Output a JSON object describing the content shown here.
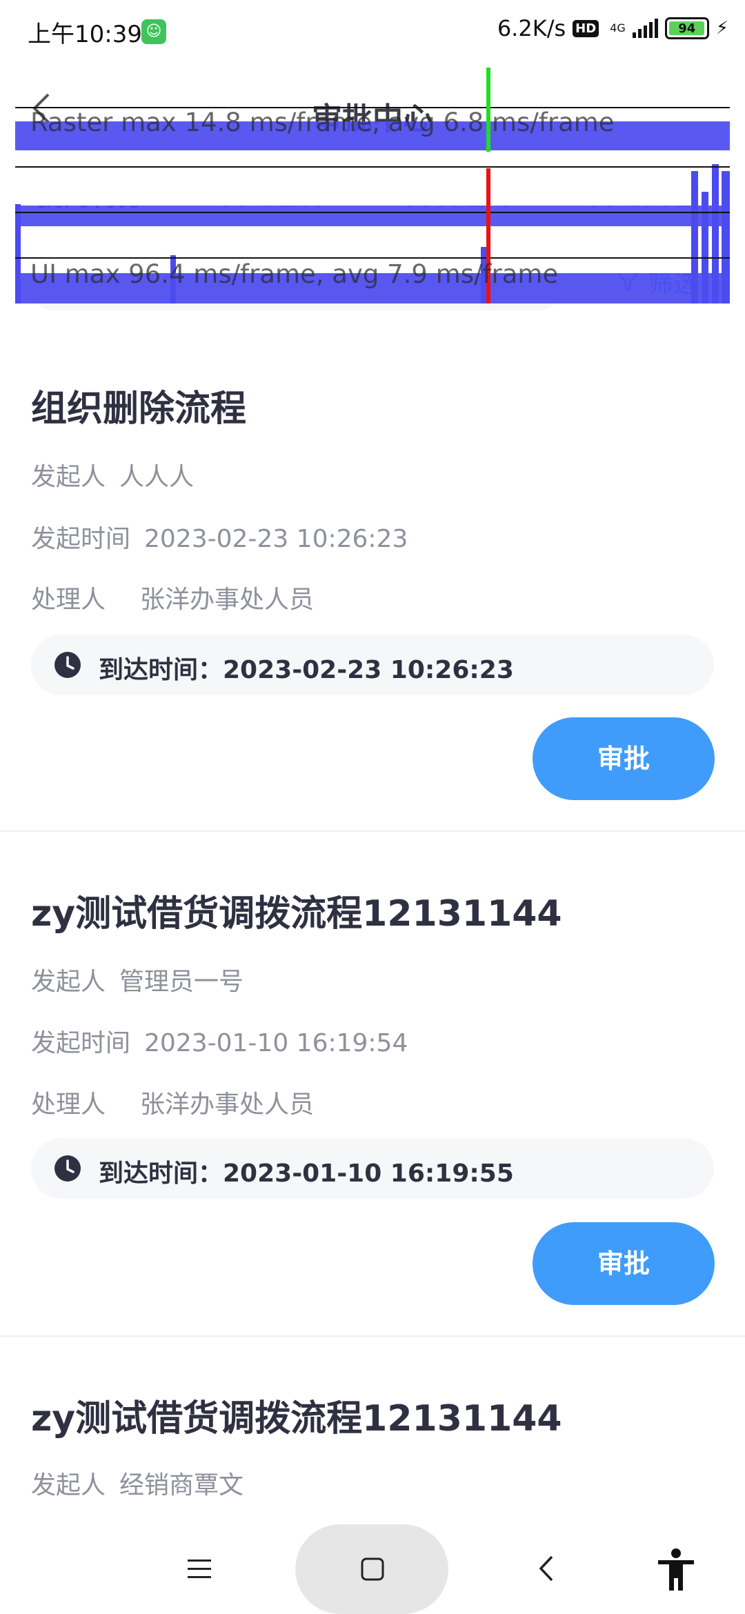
{
  "status_bar": {
    "time": "上午10:39",
    "speed": "6.2K/s",
    "hd": "HD",
    "network": "4G",
    "battery": "94"
  },
  "header": {
    "title": "审批中心"
  },
  "tabs": [
    {
      "label": "我的待办",
      "badge": "34",
      "active": true
    },
    {
      "label": "我的已办",
      "active": false
    },
    {
      "label": "我发起的",
      "active": false
    },
    {
      "label": "我的阅看",
      "active": false
    }
  ],
  "filter": {
    "label": "筛选"
  },
  "perf_overlay": {
    "raster": "Raster  max 14.8 ms/frame, avg 6.8 ms/frame",
    "ui": "UI  max 96.4 ms/frame, avg 7.9 ms/frame"
  },
  "labels": {
    "initiator": "发起人",
    "start_time": "发起时间",
    "handler": "处理人",
    "arrive_prefix": "到达时间：",
    "approve": "审批"
  },
  "cards": [
    {
      "title": "组织删除流程",
      "initiator": "人人人",
      "start_time": "2023-02-23 10:26:23",
      "handler": "张洋办事处人员",
      "arrive": "到达时间：2023-02-23 10:26:23"
    },
    {
      "title": "zy测试借货调拨流程12131144",
      "initiator": "管理员一号",
      "start_time": "2023-01-10 16:19:54",
      "handler": "张洋办事处人员",
      "arrive": "到达时间：2023-01-10 16:19:55"
    },
    {
      "title": "zy测试借货调拨流程12131144",
      "initiator": "经销商覃文"
    }
  ],
  "colors": {
    "accent": "#3f9cfb",
    "badge": "#ff5a5a",
    "title_text": "#2f3142",
    "secondary_text": "#8e909b"
  }
}
